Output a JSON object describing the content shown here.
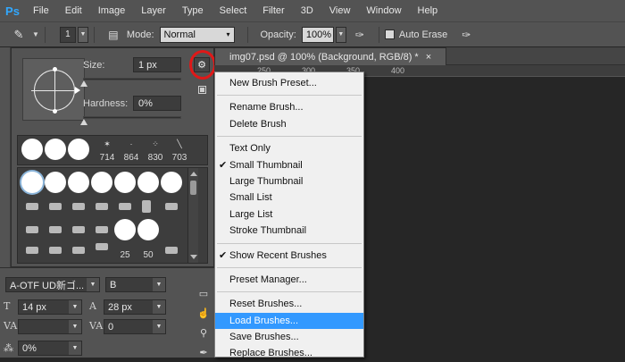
{
  "app": {
    "logo": "Ps"
  },
  "menubar": {
    "items": [
      "File",
      "Edit",
      "Image",
      "Layer",
      "Type",
      "Select",
      "Filter",
      "3D",
      "View",
      "Window",
      "Help"
    ]
  },
  "options_bar": {
    "brush_size": "1",
    "mode_label": "Mode:",
    "mode_value": "Normal",
    "opacity_label": "Opacity:",
    "opacity_value": "100%",
    "auto_erase_label": "Auto Erase"
  },
  "brush_panel": {
    "size_label": "Size:",
    "size_value": "1 px",
    "hardness_label": "Hardness:",
    "hardness_value": "0%",
    "recent_numbers": [
      "714",
      "864",
      "830",
      "703"
    ],
    "grid_numbers": [
      "25",
      "50"
    ]
  },
  "char_panel": {
    "font_family": "A-OTF UD新ゴ...",
    "font_style": "B",
    "font_size": "14 px",
    "leading": "28 px",
    "kerning": "0",
    "tracking": "0%"
  },
  "document": {
    "tab_title": "img07.psd @ 100% (Background, RGB/8) *",
    "close_glyph": "×",
    "ruler_numbers": [
      "250",
      "300",
      "350",
      "400"
    ]
  },
  "context_menu": {
    "groups": [
      [
        {
          "label": "New Brush Preset..."
        }
      ],
      [
        {
          "label": "Rename Brush..."
        },
        {
          "label": "Delete Brush"
        }
      ],
      [
        {
          "label": "Text Only"
        },
        {
          "label": "Small Thumbnail",
          "checked": true
        },
        {
          "label": "Large Thumbnail"
        },
        {
          "label": "Small List"
        },
        {
          "label": "Large List"
        },
        {
          "label": "Stroke Thumbnail"
        }
      ],
      [
        {
          "label": "Show Recent Brushes",
          "checked": true
        }
      ],
      [
        {
          "label": "Preset Manager..."
        }
      ],
      [
        {
          "label": "Reset Brushes..."
        },
        {
          "label": "Load Brushes...",
          "highlighted": true
        },
        {
          "label": "Save Brushes..."
        },
        {
          "label": "Replace Brushes..."
        }
      ]
    ]
  },
  "colors": {
    "highlight_ring": "#e01818",
    "menu_selection": "#3399ff",
    "chrome": "#535353"
  }
}
